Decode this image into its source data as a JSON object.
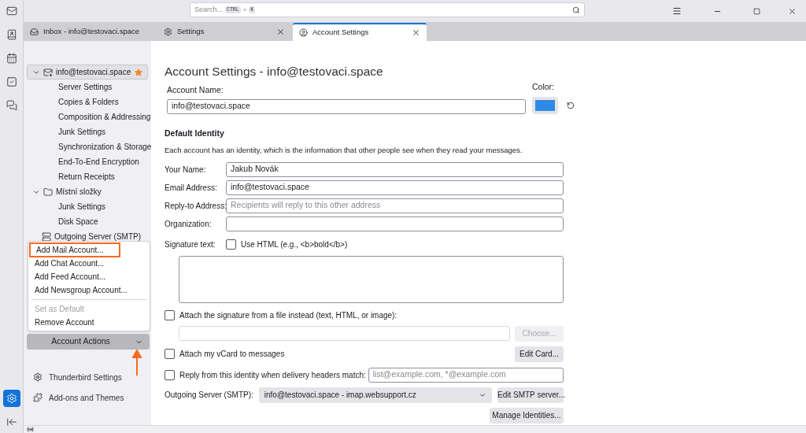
{
  "spaces_toolbar": [
    {
      "kind": "mail",
      "selected": false
    },
    {
      "kind": "address-book",
      "selected": false
    },
    {
      "kind": "calendar",
      "selected": false
    },
    {
      "kind": "tasks",
      "selected": false
    },
    {
      "kind": "chat",
      "selected": false
    }
  ],
  "spaces_footer": [
    {
      "kind": "settings",
      "selected": true
    },
    {
      "kind": "collapse",
      "selected": false
    }
  ],
  "search": {
    "placeholder": "Search...",
    "shortcut_keys": [
      "CTRL",
      "K"
    ],
    "key_joiner": "+"
  },
  "tabs": [
    {
      "label": "Inbox - info@testovaci.space",
      "kind": "inbox",
      "closable": false,
      "selected": false
    },
    {
      "label": "Settings",
      "kind": "settings",
      "closable": true,
      "selected": false
    },
    {
      "label": "Account Settings",
      "kind": "account",
      "closable": true,
      "selected": true
    }
  ],
  "account_tree": [
    {
      "label": "info@testovaci.space",
      "kind": "account",
      "expanded": true,
      "selected": true,
      "default": true,
      "children": [
        {
          "label": "Server Settings"
        },
        {
          "label": "Copies & Folders"
        },
        {
          "label": "Composition & Addressing"
        },
        {
          "label": "Junk Settings"
        },
        {
          "label": "Synchronization & Storage"
        },
        {
          "label": "End-To-End Encryption"
        },
        {
          "label": "Return Receipts"
        }
      ]
    },
    {
      "label": "Místní složky",
      "kind": "folder",
      "expanded": true,
      "selected": false,
      "default": false,
      "children": [
        {
          "label": "Junk Settings"
        },
        {
          "label": "Disk Space"
        }
      ]
    },
    {
      "label": "Outgoing Server (SMTP)",
      "kind": "smtp",
      "selected": false,
      "default": false
    }
  ],
  "account_actions": {
    "label": "Account Actions",
    "expanded": true,
    "menu": [
      {
        "kind": "item",
        "label": "Add Mail Account...",
        "disabled": false,
        "highlighted": true
      },
      {
        "kind": "item",
        "label": "Add Chat Account...",
        "disabled": false,
        "highlighted": false
      },
      {
        "kind": "item",
        "label": "Add Feed Account...",
        "disabled": false,
        "highlighted": false
      },
      {
        "kind": "item",
        "label": "Add Newsgroup Account...",
        "disabled": false,
        "highlighted": false
      },
      {
        "kind": "separator"
      },
      {
        "kind": "item",
        "label": "Set as Default",
        "disabled": true,
        "highlighted": false
      },
      {
        "kind": "item",
        "label": "Remove Account",
        "disabled": false,
        "highlighted": false
      }
    ]
  },
  "sidebar_footer": [
    {
      "kind": "settings",
      "label": "Thunderbird Settings"
    },
    {
      "kind": "addons",
      "label": "Add-ons and Themes"
    }
  ],
  "page": {
    "title": "Account Settings - info@testovaci.space",
    "account_name": {
      "label": "Account Name:",
      "value": "info@testovaci.space"
    },
    "color_picker": {
      "label": "Color:",
      "color": "#2f8ae6"
    },
    "identity": {
      "heading": "Default Identity",
      "description": "Each account has an identity, which is the information that other people see when they read your messages.",
      "fields": [
        {
          "label": "Your Name:",
          "value": "Jakub Novák"
        },
        {
          "label": "Email Address:",
          "value": "info@testovaci.space"
        },
        {
          "label": "Reply-to Address:",
          "placeholder": "Recipients will reply to this other address"
        },
        {
          "label": "Organization:"
        }
      ]
    },
    "signature": {
      "label": "Signature text:",
      "use_html": {
        "label": "Use HTML (e.g., <b>bold</b>)",
        "checked": false
      }
    },
    "attach_file": {
      "label": "Attach the signature from a file instead (text, HTML, or image):",
      "checked": false,
      "choose_button": {
        "label": "Choose...",
        "disabled": true
      }
    },
    "vcard": {
      "label": "Attach my vCard to messages",
      "checked": false,
      "button": "Edit Card..."
    },
    "reply_from": {
      "label": "Reply from this identity when delivery headers match:",
      "checked": false,
      "placeholder": "list@example.com, *@example.com"
    },
    "smtp": {
      "label": "Outgoing Server (SMTP):",
      "value": "info@testovaci.space - imap.websupport.cz",
      "button": "Edit SMTP server..."
    },
    "manage_button": "Manage Identities..."
  }
}
